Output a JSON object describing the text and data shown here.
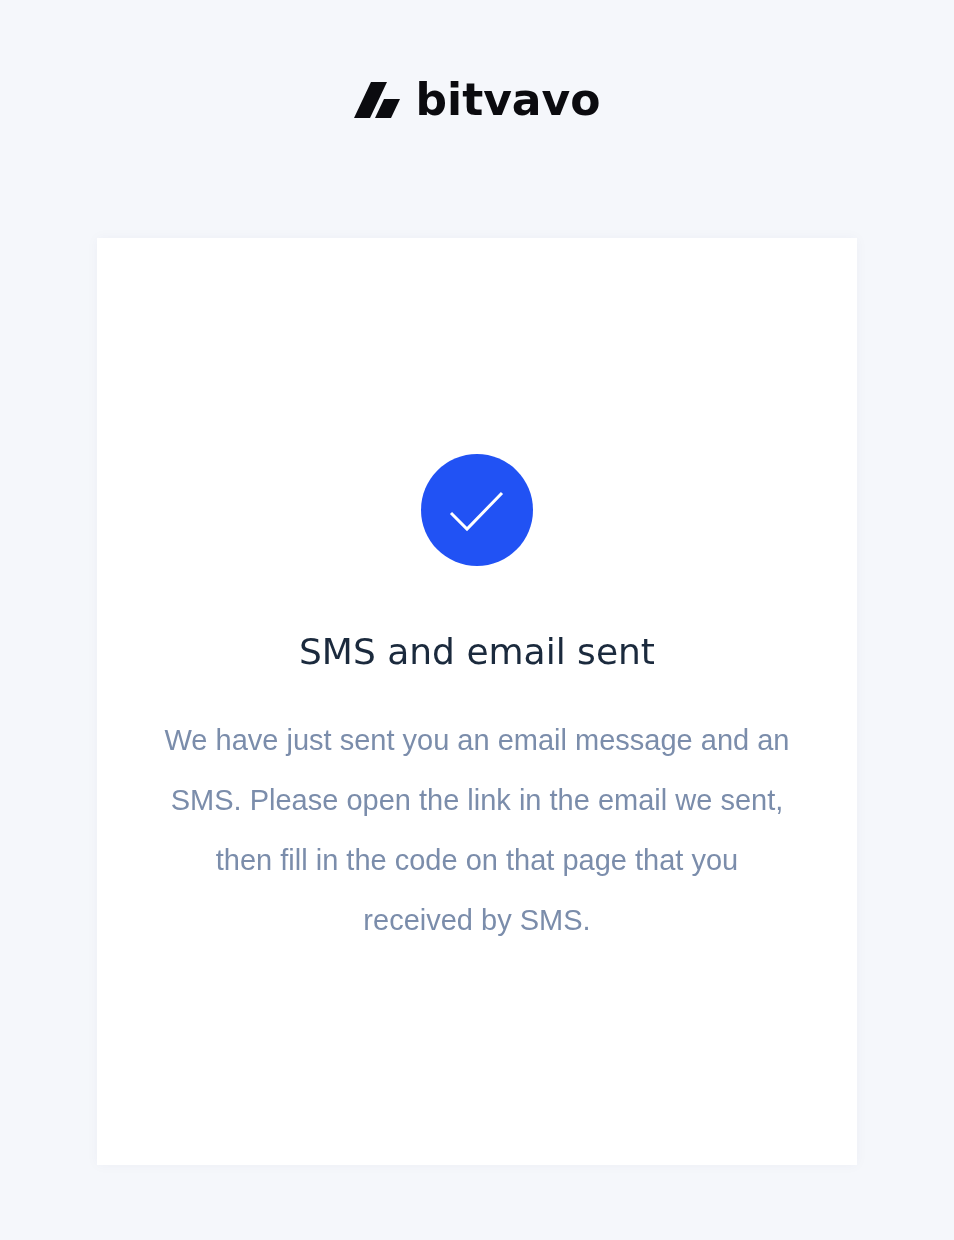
{
  "header": {
    "logo": {
      "wordmark": "bitvavo"
    }
  },
  "card": {
    "title": "SMS and email sent",
    "message": "We have just sent you an email message and an SMS. Please open the link in the email we sent, then fill in the code on that page that you received by SMS."
  }
}
